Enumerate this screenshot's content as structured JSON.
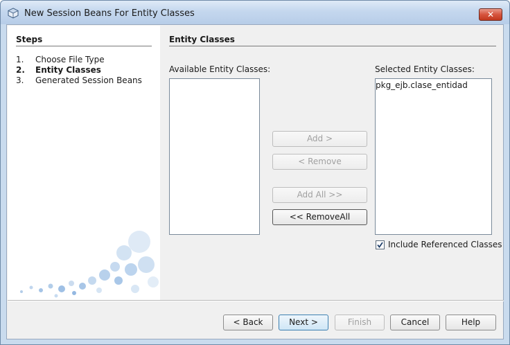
{
  "window": {
    "title": "New Session Beans For Entity Classes",
    "close_glyph": "✕"
  },
  "steps": {
    "heading": "Steps",
    "items": [
      {
        "num": "1.",
        "label": "Choose File Type"
      },
      {
        "num": "2.",
        "label": "Entity Classes",
        "current": true
      },
      {
        "num": "3.",
        "label": "Generated Session Beans"
      }
    ]
  },
  "main": {
    "title": "Entity Classes",
    "available_label": "Available Entity Classes:",
    "available_items": [],
    "selected_label": "Selected Entity Classes:",
    "selected_items": [
      "pkg_ejb.clase_entidad"
    ],
    "buttons": {
      "add": "Add >",
      "remove": "< Remove",
      "add_all": "Add All >>",
      "remove_all": "<< RemoveAll"
    },
    "include_referenced": {
      "label": "Include Referenced Classes",
      "checked": true
    }
  },
  "footer": {
    "back": "< Back",
    "next": "Next >",
    "finish": "Finish",
    "cancel": "Cancel",
    "help": "Help"
  },
  "icons": {
    "app": "netbeans-cube-icon",
    "close": "close-icon",
    "check": "checkmark-icon"
  }
}
